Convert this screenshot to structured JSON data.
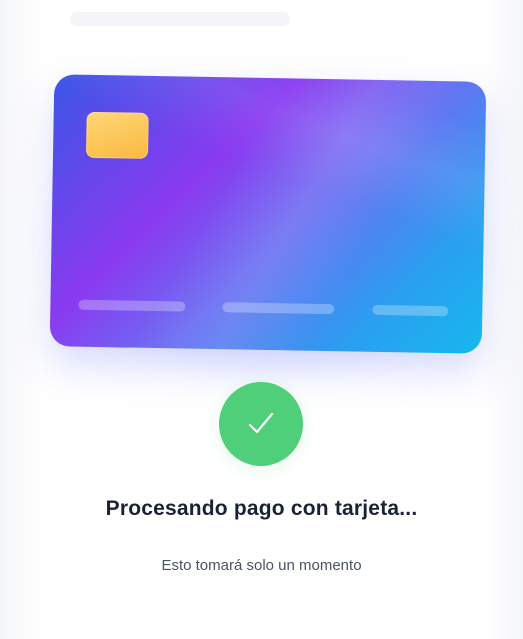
{
  "status": {
    "title": "Procesando pago con tarjeta...",
    "subtitle": "Esto tomará solo un momento",
    "state_icon": "check-icon"
  },
  "card": {
    "chip_icon": "card-chip-icon"
  },
  "colors": {
    "success": "#4fcf79",
    "chip": "#f9b93f",
    "card_gradient_start": "#3b56e6",
    "card_gradient_mid": "#8a3af0",
    "card_gradient_end": "#16b8ee",
    "title_text": "#1a2233",
    "subtitle_text": "#4a5466"
  }
}
